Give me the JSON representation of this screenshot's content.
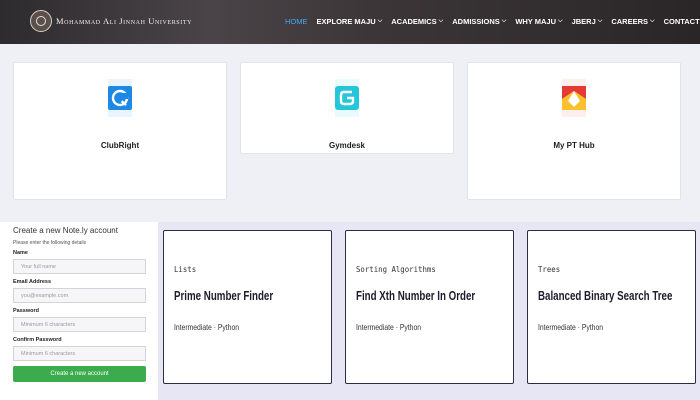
{
  "header": {
    "logo_title": "Mohammad Ali Jinnah University",
    "logo_subtitle": " ",
    "nav": [
      {
        "label": "HOME",
        "active": true,
        "dropdown": false
      },
      {
        "label": "EXPLORE MAJU",
        "active": false,
        "dropdown": true
      },
      {
        "label": "ACADEMICS",
        "active": false,
        "dropdown": true
      },
      {
        "label": "ADMISSIONS",
        "active": false,
        "dropdown": true
      },
      {
        "label": "WHY MAJU",
        "active": false,
        "dropdown": true
      },
      {
        "label": "JBERJ",
        "active": false,
        "dropdown": true
      },
      {
        "label": "CAREERS",
        "active": false,
        "dropdown": true
      },
      {
        "label": "CONTACT",
        "active": false,
        "dropdown": false
      }
    ],
    "search_icon": "search-icon"
  },
  "apps": [
    {
      "name": "ClubRight",
      "icon": "clubright-logo",
      "color": "#1e88e5"
    },
    {
      "name": "Gymdesk",
      "icon": "gymdesk-logo",
      "color": "#26c6da"
    },
    {
      "name": "My PT Hub",
      "icon": "mypthub-logo",
      "color": "#e53935"
    }
  ],
  "signup": {
    "title": "Create a new Note.ly account",
    "subtitle": "Please enter the following details",
    "fields": [
      {
        "label": "Name",
        "placeholder": "Your full name"
      },
      {
        "label": "Email Address",
        "placeholder": "you@example.com"
      },
      {
        "label": "Password",
        "placeholder": "Minimum 6 characters"
      },
      {
        "label": "Confirm Password",
        "placeholder": "Minimum 6 characters"
      }
    ],
    "submit_label": "Create a new account",
    "submit_color": "#3cab4b"
  },
  "exercises": [
    {
      "category": "Lists",
      "title": "Prime Number Finder",
      "meta": "Intermediate · Python"
    },
    {
      "category": "Sorting Algorithms",
      "title": "Find Xth Number In Order",
      "meta": "Intermediate · Python"
    },
    {
      "category": "Trees",
      "title": "Balanced Binary Search Tree",
      "meta": "Intermediate · Python"
    }
  ],
  "colors": {
    "nav_active": "#3fa9f5",
    "panel_bg": "#e7e6f4",
    "card_border": "#2b2d45"
  }
}
